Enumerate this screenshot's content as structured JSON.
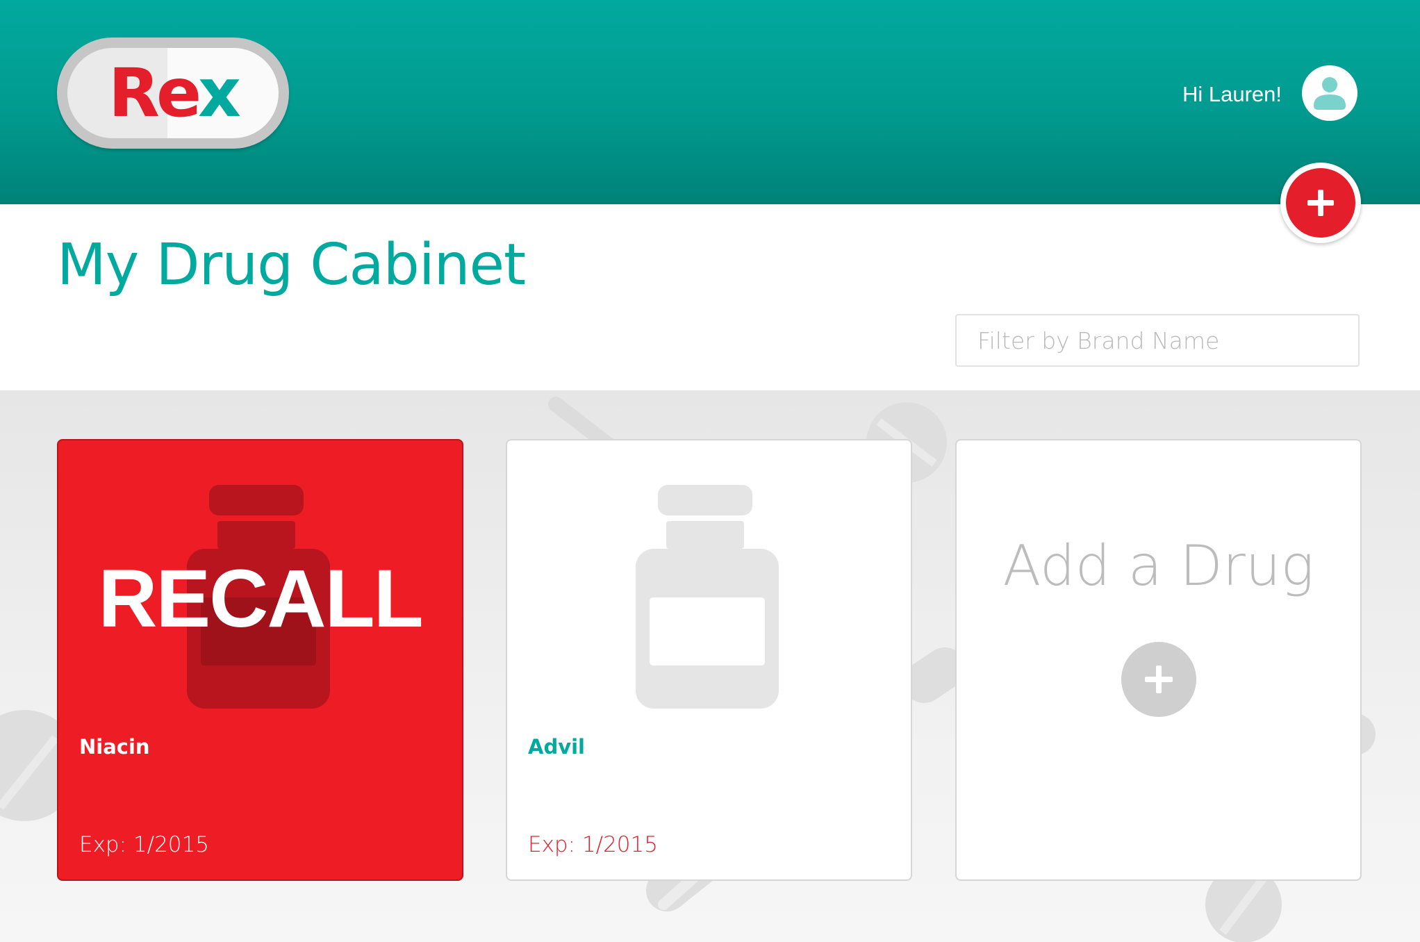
{
  "header": {
    "logo_text": "ReX",
    "greeting": "Hi Lauren!",
    "avatar_icon": "user-icon"
  },
  "title": "My Drug Cabinet",
  "filter": {
    "placeholder": "Filter by Brand Name",
    "value": ""
  },
  "add_button_icon": "plus-icon",
  "cards": [
    {
      "name": "Niacin",
      "exp": "Exp: 1/2015",
      "status": "RECALL",
      "recalled": true
    },
    {
      "name": "Advil",
      "exp": "Exp: 1/2015",
      "recalled": false
    }
  ],
  "add_card": {
    "label": "Add a Drug",
    "icon": "plus-icon"
  },
  "colors": {
    "primary": "#02a99e",
    "accent": "#e41e2a",
    "recall": "#ee1c25",
    "muted": "#bcbcbc"
  }
}
